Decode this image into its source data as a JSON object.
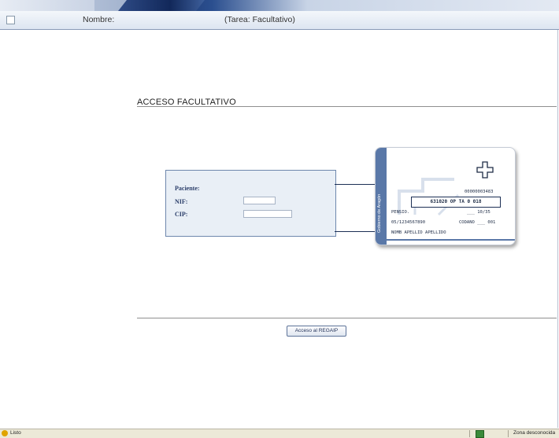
{
  "header": {
    "nombre_label": "Nombre:",
    "tarea_label": "(Tarea: Facultativo)"
  },
  "main": {
    "section_title": "ACCESO FACULTATIVO",
    "form": {
      "paciente_label": "Paciente:",
      "nif_label": "NIF:",
      "nif_value": "",
      "cip_label": "CIP:",
      "cip_value": ""
    },
    "submit_label": "Acceso al REGAIP"
  },
  "card": {
    "number_top": "00000003483",
    "code_box": "631020  OP  TA  0  018",
    "line1_left": "PENSIO.",
    "line1_right": "___ 10/35",
    "line2_left": "05/1234567890",
    "line2_right": "CODANO  ___ 001",
    "name_line": "NOMB  APELLID  APELLIDO",
    "strip_text": "Gobierno de Aragón"
  },
  "status": {
    "left": "Listo",
    "right": "Zona desconocida"
  },
  "colors": {
    "header_bg": "#dde5f1",
    "form_bg": "#e9eff6",
    "card_strip": "#5a78a8",
    "line_color": "#1c2f55"
  }
}
